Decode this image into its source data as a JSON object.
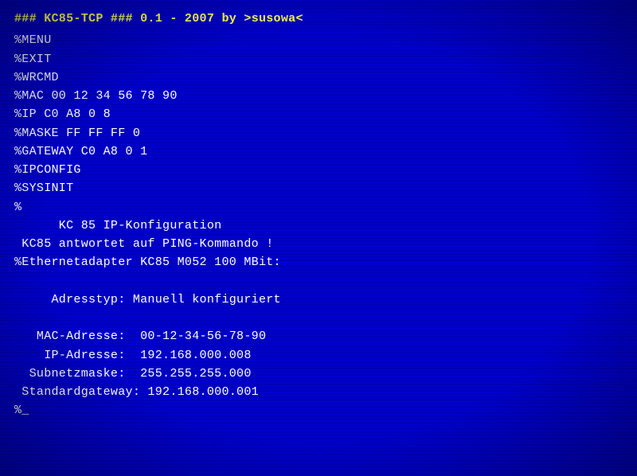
{
  "terminal": {
    "title": "### KC85-TCP ### 0.1 - 2007 by >susowa<",
    "commands": [
      "%MENU",
      "%EXIT",
      "%WRCMD",
      "%MAC 00 12 34 56 78 90",
      "%IP C0 A8 0 8",
      "%MASKE FF FF FF 0",
      "%GATEWAY C0 A8 0 1",
      "%IPCONFIG",
      "%SYSINIT",
      "%"
    ],
    "info_header": "      KC 85 IP-Konfiguration",
    "ping_line": " KC85 antwortet auf PING-Kommando !",
    "adapter_line": "%Ethernetadapter KC85 M052 100 MBit:",
    "blank": "",
    "addr_type": "     Adresstyp: Manuell konfiguriert",
    "blank2": "",
    "mac_line": "   MAC-Adresse:  00-12-34-56-78-90",
    "ip_line": "    IP-Adresse:  192.168.000.008",
    "subnet_line": "  Subnetzmaske:  255.255.255.000",
    "gateway_line": " Standardgateway: 192.168.000.001",
    "prompt": "%_"
  }
}
